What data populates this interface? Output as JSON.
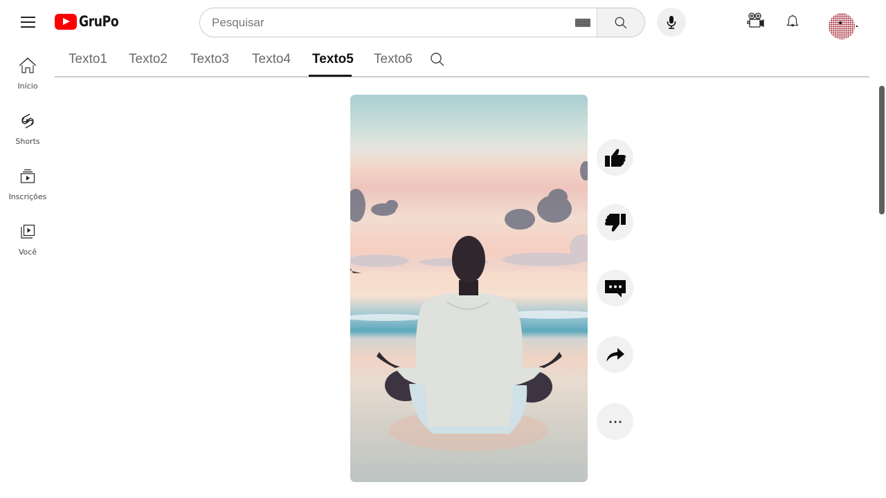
{
  "header": {
    "brand": "GruPo",
    "search": {
      "value": "",
      "placeholder": "Pesquisar"
    },
    "icons": {
      "menu": "hamburger-menu-icon",
      "keyboard": "keyboard-icon",
      "search": "search-icon",
      "mic": "microphone-icon",
      "create": "video-camera-icon",
      "notifications": "bell-icon",
      "avatar": "avatar"
    }
  },
  "sidebar": {
    "items": [
      {
        "label": "Início",
        "icon": "home-icon"
      },
      {
        "label": "Shorts",
        "icon": "shorts-icon"
      },
      {
        "label": "Inscrições",
        "icon": "subscriptions-icon"
      },
      {
        "label": "Você",
        "icon": "library-icon"
      }
    ]
  },
  "tabs": {
    "items": [
      {
        "label": "Texto1",
        "active": false
      },
      {
        "label": "Texto2",
        "active": false
      },
      {
        "label": "Texto3",
        "active": false
      },
      {
        "label": "Texto4",
        "active": false
      },
      {
        "label": "Texto5",
        "active": true
      },
      {
        "label": "Texto6",
        "active": false
      }
    ],
    "search_icon": "search-icon"
  },
  "short": {
    "description": "Person meditating cross-legged on a beach at sunset, viewed from behind"
  },
  "actions": [
    {
      "name": "like",
      "icon": "thumbs-up-icon"
    },
    {
      "name": "dislike",
      "icon": "thumbs-down-icon"
    },
    {
      "name": "comments",
      "icon": "comment-icon"
    },
    {
      "name": "share",
      "icon": "share-icon"
    },
    {
      "name": "more",
      "icon": "more-horizontal-icon"
    }
  ],
  "colors": {
    "brand_red": "#ff0000",
    "active_tab": "#0f0f0f",
    "inactive_tab": "#6a6a6a",
    "action_bg": "#f1f1f1"
  }
}
